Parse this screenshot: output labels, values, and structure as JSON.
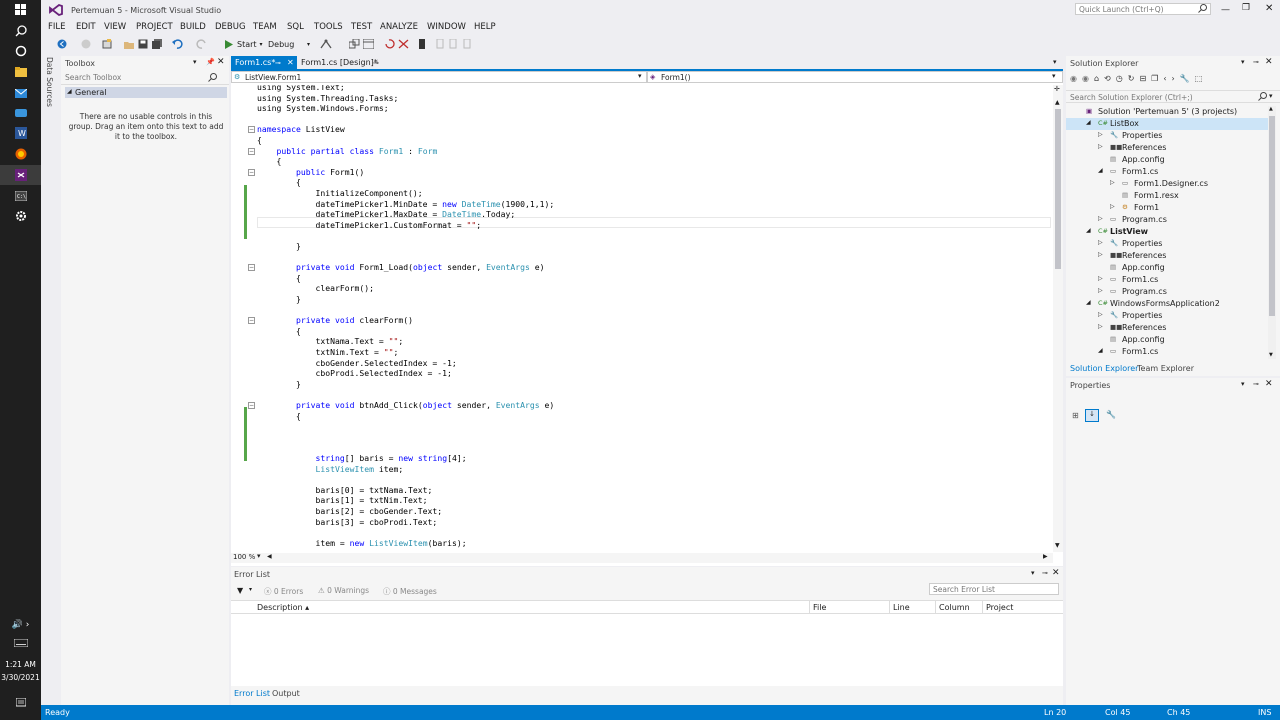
{
  "window": {
    "title": "Pertemuan 5 - Microsoft Visual Studio",
    "quick_launch": "Quick Launch (Ctrl+Q)"
  },
  "menu": [
    "FILE",
    "EDIT",
    "VIEW",
    "PROJECT",
    "BUILD",
    "DEBUG",
    "TEAM",
    "SQL",
    "TOOLS",
    "TEST",
    "ANALYZE",
    "WINDOW",
    "HELP"
  ],
  "toolbar": {
    "start_label": "Start",
    "config_label": "Debug"
  },
  "sidetab": {
    "label": "Data Sources"
  },
  "toolbox": {
    "title": "Toolbox",
    "search_placeholder": "Search Toolbox",
    "group": "General",
    "empty_message": "There are no usable controls in this group. Drag an item onto this text to add it to the toolbox."
  },
  "editor": {
    "tabs": [
      {
        "label": "Form1.cs*"
      },
      {
        "label": "Form1.cs [Design]*"
      }
    ],
    "nav_left": "ListView.Form1",
    "nav_right": "Form1()",
    "zoom": "100 %",
    "lines": [
      {
        "html": "using System.Text;"
      },
      {
        "html": "using System.Threading.Tasks;"
      },
      {
        "html": "using System.Windows.Forms;"
      },
      {
        "html": ""
      },
      {
        "html": "<span class=\"kw\">namespace</span> ListView"
      },
      {
        "html": "{"
      },
      {
        "html": "    <span class=\"kw\">public partial class</span> <span class=\"ty\">Form1</span> : <span class=\"ty\">Form</span>"
      },
      {
        "html": "    {"
      },
      {
        "html": "        <span class=\"kw\">public</span> Form1()"
      },
      {
        "html": "        {"
      },
      {
        "html": "            InitializeComponent();"
      },
      {
        "html": "            dateTimePicker1.MinDate = <span class=\"kw\">new</span> <span class=\"ty\">DateTime</span>(1900,1,1);"
      },
      {
        "html": "            dateTimePicker1.MaxDate = <span class=\"ty\">DateTime</span>.Today;"
      },
      {
        "html": "            dateTimePicker1.CustomFormat = <span class=\"st\">\"\"</span>;"
      },
      {
        "html": ""
      },
      {
        "html": "        }"
      },
      {
        "html": ""
      },
      {
        "html": "        <span class=\"kw\">private void</span> Form1_Load(<span class=\"kw\">object</span> sender, <span class=\"ty\">EventArgs</span> e)"
      },
      {
        "html": "        {"
      },
      {
        "html": "            clearForm();"
      },
      {
        "html": "        }"
      },
      {
        "html": ""
      },
      {
        "html": "        <span class=\"kw\">private void</span> clearForm()"
      },
      {
        "html": "        {"
      },
      {
        "html": "            txtNama.Text = <span class=\"st\">\"\"</span>;"
      },
      {
        "html": "            txtNim.Text = <span class=\"st\">\"\"</span>;"
      },
      {
        "html": "            cboGender.SelectedIndex = -1;"
      },
      {
        "html": "            cboProdi.SelectedIndex = -1;"
      },
      {
        "html": "        }"
      },
      {
        "html": ""
      },
      {
        "html": "        <span class=\"kw\">private void</span> btnAdd_Click(<span class=\"kw\">object</span> sender, <span class=\"ty\">EventArgs</span> e)"
      },
      {
        "html": "        {"
      },
      {
        "html": ""
      },
      {
        "html": ""
      },
      {
        "html": ""
      },
      {
        "html": "            <span class=\"kw\">string</span>[] baris = <span class=\"kw\">new string</span>[4];"
      },
      {
        "html": "            <span class=\"ty\">ListViewItem</span> item;"
      },
      {
        "html": ""
      },
      {
        "html": "            baris[0] = txtNama.Text;"
      },
      {
        "html": "            baris[1] = txtNim.Text;"
      },
      {
        "html": "            baris[2] = cboGender.Text;"
      },
      {
        "html": "            baris[3] = cboProdi.Text;"
      },
      {
        "html": ""
      },
      {
        "html": "            item = <span class=\"kw\">new</span> <span class=\"ty\">ListViewItem</span>(baris);"
      }
    ]
  },
  "errorlist": {
    "title": "Error List",
    "errors": "0 Errors",
    "warnings": "0 Warnings",
    "messages": "0 Messages",
    "search_placeholder": "Search Error List",
    "columns": [
      "Description",
      "File",
      "Line",
      "Column",
      "Project"
    ],
    "bottom_tabs": [
      "Error List",
      "Output"
    ]
  },
  "solution_explorer": {
    "title": "Solution Explorer",
    "search_placeholder": "Search Solution Explorer (Ctrl+;)",
    "items": [
      {
        "label": "Solution 'Pertemuan 5' (3 projects)",
        "depth": 0,
        "bold": false,
        "selected": false
      },
      {
        "label": "ListBox",
        "depth": 1,
        "bold": false,
        "selected": true
      },
      {
        "label": "Properties",
        "depth": 2,
        "bold": false,
        "selected": false
      },
      {
        "label": "References",
        "depth": 2,
        "bold": false,
        "selected": false
      },
      {
        "label": "App.config",
        "depth": 2,
        "bold": false,
        "selected": false
      },
      {
        "label": "Form1.cs",
        "depth": 2,
        "bold": false,
        "selected": false
      },
      {
        "label": "Form1.Designer.cs",
        "depth": 3,
        "bold": false,
        "selected": false
      },
      {
        "label": "Form1.resx",
        "depth": 3,
        "bold": false,
        "selected": false
      },
      {
        "label": "Form1",
        "depth": 3,
        "bold": false,
        "selected": false
      },
      {
        "label": "Program.cs",
        "depth": 2,
        "bold": false,
        "selected": false
      },
      {
        "label": "ListView",
        "depth": 1,
        "bold": true,
        "selected": false
      },
      {
        "label": "Properties",
        "depth": 2,
        "bold": false,
        "selected": false
      },
      {
        "label": "References",
        "depth": 2,
        "bold": false,
        "selected": false
      },
      {
        "label": "App.config",
        "depth": 2,
        "bold": false,
        "selected": false
      },
      {
        "label": "Form1.cs",
        "depth": 2,
        "bold": false,
        "selected": false
      },
      {
        "label": "Program.cs",
        "depth": 2,
        "bold": false,
        "selected": false
      },
      {
        "label": "WindowsFormsApplication2",
        "depth": 1,
        "bold": false,
        "selected": false
      },
      {
        "label": "Properties",
        "depth": 2,
        "bold": false,
        "selected": false
      },
      {
        "label": "References",
        "depth": 2,
        "bold": false,
        "selected": false
      },
      {
        "label": "App.config",
        "depth": 2,
        "bold": false,
        "selected": false
      },
      {
        "label": "Form1.cs",
        "depth": 2,
        "bold": false,
        "selected": false
      }
    ],
    "tabs": [
      "Solution Explorer",
      "Team Explorer"
    ]
  },
  "properties": {
    "title": "Properties"
  },
  "status": {
    "ready": "Ready",
    "ln": "Ln 20",
    "col": "Col 45",
    "ch": "Ch 45",
    "ins": "INS"
  },
  "clock": {
    "time": "1:21 AM",
    "date": "3/30/2021"
  },
  "colors": {
    "accent": "#007acc",
    "vs_purple": "#68217a",
    "change_green": "#57a64a"
  }
}
